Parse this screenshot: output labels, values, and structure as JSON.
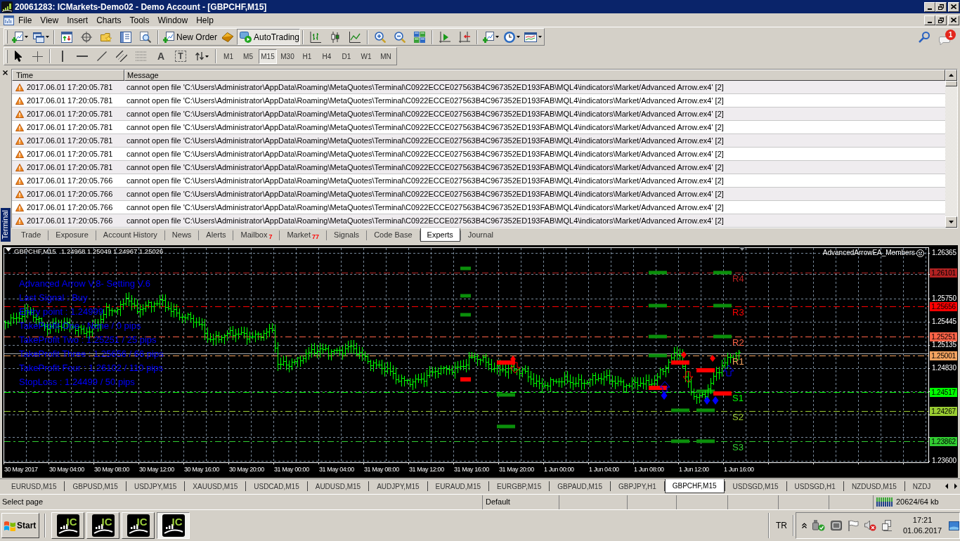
{
  "window": {
    "title": "20061283: ICMarkets-Demo02 - Demo Account - [GBPCHF,M15]"
  },
  "menu": [
    "File",
    "View",
    "Insert",
    "Charts",
    "Tools",
    "Window",
    "Help"
  ],
  "toolbar": {
    "new_order": "New Order",
    "autotrading": {
      "label": "AutoTrading",
      "on": true
    },
    "notification_count": "1"
  },
  "drawing_tools": {
    "text_glyph": "A",
    "label_glyph": "T"
  },
  "timeframes": [
    {
      "label": "M1",
      "selected": false
    },
    {
      "label": "M5",
      "selected": false
    },
    {
      "label": "M15",
      "selected": true
    },
    {
      "label": "M30",
      "selected": false
    },
    {
      "label": "H1",
      "selected": false
    },
    {
      "label": "H4",
      "selected": false
    },
    {
      "label": "D1",
      "selected": false
    },
    {
      "label": "W1",
      "selected": false
    },
    {
      "label": "MN",
      "selected": false
    }
  ],
  "terminal": {
    "title": "Terminal",
    "columns": [
      "Time",
      "Message"
    ],
    "rows": [
      {
        "time": "2017.06.01 17:20:05.781",
        "message": "cannot open file 'C:\\Users\\Administrator\\AppData\\Roaming\\MetaQuotes\\Terminal\\C0922ECCE027563B4C967352ED193FAB\\MQL4\\indicators\\Market/Advanced Arrow.ex4' [2]"
      },
      {
        "time": "2017.06.01 17:20:05.781",
        "message": "cannot open file 'C:\\Users\\Administrator\\AppData\\Roaming\\MetaQuotes\\Terminal\\C0922ECCE027563B4C967352ED193FAB\\MQL4\\indicators\\Market/Advanced Arrow.ex4' [2]"
      },
      {
        "time": "2017.06.01 17:20:05.781",
        "message": "cannot open file 'C:\\Users\\Administrator\\AppData\\Roaming\\MetaQuotes\\Terminal\\C0922ECCE027563B4C967352ED193FAB\\MQL4\\indicators\\Market/Advanced Arrow.ex4' [2]"
      },
      {
        "time": "2017.06.01 17:20:05.781",
        "message": "cannot open file 'C:\\Users\\Administrator\\AppData\\Roaming\\MetaQuotes\\Terminal\\C0922ECCE027563B4C967352ED193FAB\\MQL4\\indicators\\Market/Advanced Arrow.ex4' [2]"
      },
      {
        "time": "2017.06.01 17:20:05.781",
        "message": "cannot open file 'C:\\Users\\Administrator\\AppData\\Roaming\\MetaQuotes\\Terminal\\C0922ECCE027563B4C967352ED193FAB\\MQL4\\indicators\\Market/Advanced Arrow.ex4' [2]"
      },
      {
        "time": "2017.06.01 17:20:05.781",
        "message": "cannot open file 'C:\\Users\\Administrator\\AppData\\Roaming\\MetaQuotes\\Terminal\\C0922ECCE027563B4C967352ED193FAB\\MQL4\\indicators\\Market/Advanced Arrow.ex4' [2]"
      },
      {
        "time": "2017.06.01 17:20:05.781",
        "message": "cannot open file 'C:\\Users\\Administrator\\AppData\\Roaming\\MetaQuotes\\Terminal\\C0922ECCE027563B4C967352ED193FAB\\MQL4\\indicators\\Market/Advanced Arrow.ex4' [2]"
      },
      {
        "time": "2017.06.01 17:20:05.766",
        "message": "cannot open file 'C:\\Users\\Administrator\\AppData\\Roaming\\MetaQuotes\\Terminal\\C0922ECCE027563B4C967352ED193FAB\\MQL4\\indicators\\Market/Advanced Arrow.ex4' [2]"
      },
      {
        "time": "2017.06.01 17:20:05.766",
        "message": "cannot open file 'C:\\Users\\Administrator\\AppData\\Roaming\\MetaQuotes\\Terminal\\C0922ECCE027563B4C967352ED193FAB\\MQL4\\indicators\\Market/Advanced Arrow.ex4' [2]"
      },
      {
        "time": "2017.06.01 17:20:05.766",
        "message": "cannot open file 'C:\\Users\\Administrator\\AppData\\Roaming\\MetaQuotes\\Terminal\\C0922ECCE027563B4C967352ED193FAB\\MQL4\\indicators\\Market/Advanced Arrow.ex4' [2]"
      },
      {
        "time": "2017.06.01 17:20:05.766",
        "message": "cannot open file 'C:\\Users\\Administrator\\AppData\\Roaming\\MetaQuotes\\Terminal\\C0922ECCE027563B4C967352ED193FAB\\MQL4\\indicators\\Market/Advanced Arrow.ex4' [2]"
      }
    ],
    "tabs": [
      {
        "label": "Trade",
        "selected": false
      },
      {
        "label": "Exposure",
        "selected": false
      },
      {
        "label": "Account History",
        "selected": false
      },
      {
        "label": "News",
        "selected": false
      },
      {
        "label": "Alerts",
        "selected": false
      },
      {
        "label": "Mailbox",
        "badge": "7",
        "selected": false
      },
      {
        "label": "Market",
        "badge": "77",
        "selected": false
      },
      {
        "label": "Signals",
        "selected": false
      },
      {
        "label": "Code Base",
        "selected": false
      },
      {
        "label": "Experts",
        "selected": true
      },
      {
        "label": "Journal",
        "selected": false
      }
    ]
  },
  "chart": {
    "symbol": "GBPCHF,M15",
    "quote": "1.24968 1.25049 1.24967 1.25026",
    "expert": "AdvancedArrowEA_Members",
    "info_lines": [
      "Advanced Arrow V.8- Setting V.6",
      "Last Signal : Buy",
      "Entry point : 1.24999",
      "TakeProfit One : None / 0 pips",
      "TakeProfit Two : 1.25251 / 25 pips",
      "TakeProfit Three : 1.25656 / 66 pips",
      "TakeProfit Four : 1.26102 / 110 pips",
      "StopLoss : 1.24499 / 50 pips"
    ],
    "levels": [
      {
        "name": "R4",
        "price": "1.26101",
        "color": "#b22222"
      },
      {
        "name": "R3",
        "price": "1.25656",
        "color": "#ff0000"
      },
      {
        "name": "R2",
        "price": "1.25251",
        "color": "#ff6347"
      },
      {
        "name": "R1",
        "price": "1.25001",
        "color": "#f4a460"
      },
      {
        "name": "S1",
        "price": "1.24517",
        "color": "#00ff00"
      },
      {
        "name": "S2",
        "price": "1.24267",
        "color": "#9acd32"
      },
      {
        "name": "S3",
        "price": "1.23862",
        "color": "#32cd32"
      }
    ],
    "price_ticks": [
      "1.26365",
      "1.25750",
      "1.25445",
      "1.25135",
      "1.24830",
      "1.23600"
    ],
    "time_labels": [
      "30 May 2017",
      "30 May 04:00",
      "30 May 08:00",
      "30 May 12:00",
      "30 May 16:00",
      "30 May 20:00",
      "31 May 00:00",
      "31 May 04:00",
      "31 May 08:00",
      "31 May 12:00",
      "31 May 16:00",
      "31 May 20:00",
      "1 Jun 00:00",
      "1 Jun 04:00",
      "1 Jun 08:00",
      "1 Jun 12:00",
      "1 Jun 16:00"
    ]
  },
  "symbol_tabs": [
    {
      "label": "EURUSD,M15",
      "selected": false
    },
    {
      "label": "GBPUSD,M15",
      "selected": false
    },
    {
      "label": "USDJPY,M15",
      "selected": false
    },
    {
      "label": "XAUUSD,M15",
      "selected": false
    },
    {
      "label": "USDCAD,M15",
      "selected": false
    },
    {
      "label": "AUDUSD,M15",
      "selected": false
    },
    {
      "label": "AUDJPY,M15",
      "selected": false
    },
    {
      "label": "EURAUD,M15",
      "selected": false
    },
    {
      "label": "EURGBP,M15",
      "selected": false
    },
    {
      "label": "GBPAUD,M15",
      "selected": false
    },
    {
      "label": "GBPJPY,H1",
      "selected": false
    },
    {
      "label": "GBPCHF,M15",
      "selected": true
    },
    {
      "label": "USDSGD,M15",
      "selected": false
    },
    {
      "label": "USDSGD,H1",
      "selected": false
    },
    {
      "label": "NZDUSD,M15",
      "selected": false
    },
    {
      "label": "NZDJ",
      "selected": false
    }
  ],
  "status_bar": {
    "hint": "Select page",
    "profile": "Default",
    "traffic": "20624/64 kb"
  },
  "taskbar": {
    "start": "Start",
    "apps": [
      {
        "logo": "IC",
        "active": false
      },
      {
        "logo": "IC",
        "active": false
      },
      {
        "logo": "IC",
        "active": false
      },
      {
        "logo": "IC",
        "active": true
      }
    ],
    "language": "TR",
    "time": "17:21",
    "date": "01.06.2017"
  }
}
